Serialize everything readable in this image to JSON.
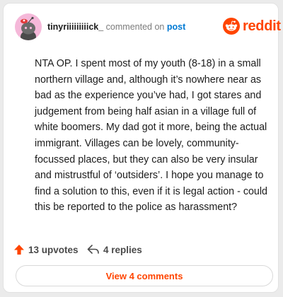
{
  "comment": {
    "username": "tinyriiiiiiiiick_",
    "commented_text": " commented on ",
    "post_link": "post",
    "body": "NTA OP. I spent most of my youth (8-18) in a small northern village and, although it’s nowhere near as bad as the experience you’ve had, I got stares and judgement from being half asian in a village full of white boomers. My dad got it more, being the actual immigrant. Villages can be lovely, community-focussed places, but they can also be very insular and mistrustful of ‘outsiders’. I hope you manage to find a solution to this, even if it is legal action - could this be reported to the police as harassment?"
  },
  "brand": {
    "name": "reddit",
    "color": "#ff4500",
    "icon": "reddit-snoo-icon"
  },
  "actions": {
    "upvotes": "13 upvotes",
    "upvote_icon": "upvote-arrow-icon",
    "replies": "4 replies",
    "reply_icon": "reply-arrow-icon"
  },
  "view_comments_label": "View 4 comments",
  "colors": {
    "accent": "#ff4500",
    "link": "#0079d3",
    "avatar_bg": "#f5b8d9"
  }
}
